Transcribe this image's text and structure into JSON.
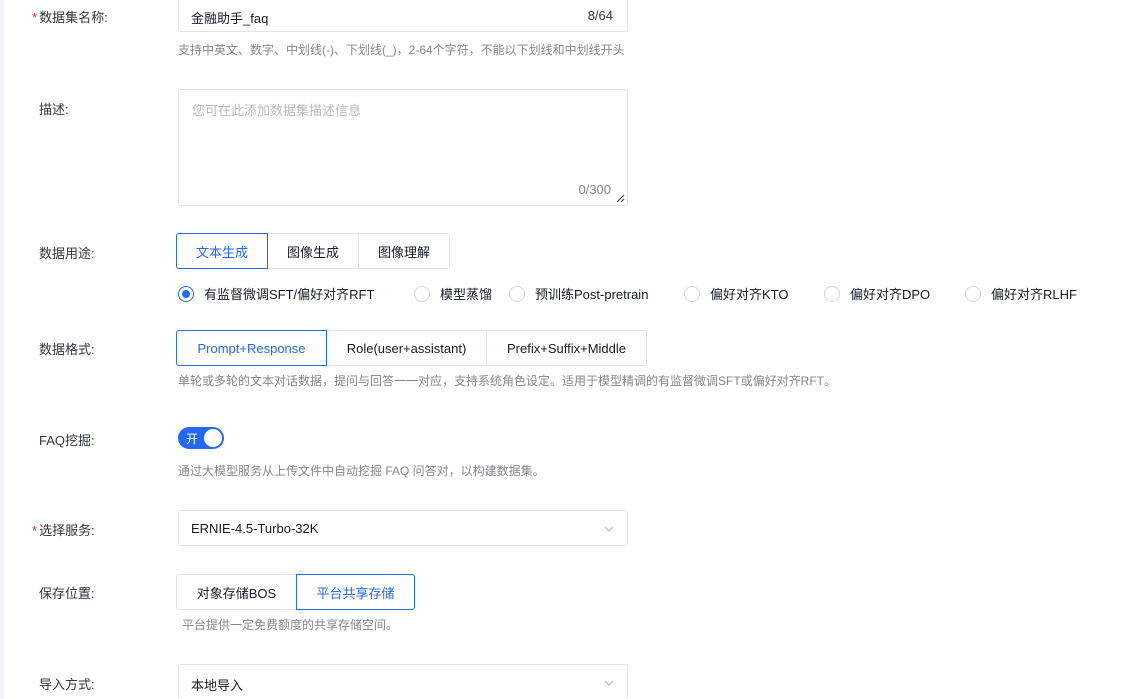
{
  "form": {
    "dataset_name": {
      "required_mark": "*",
      "label": "数据集名称:",
      "value": "金融助手_faq",
      "count": "8/64",
      "hint": "支持中英文、数字、中划线(-)、下划线(_)，2-64个字符，不能以下划线和中划线开头"
    },
    "description": {
      "label": "描述:",
      "placeholder": "您可在此添加数据集描述信息",
      "count": "0/300"
    },
    "usage": {
      "label": "数据用途:",
      "tabs": [
        "文本生成",
        "图像生成",
        "图像理解"
      ],
      "active_tab": "文本生成",
      "radios": [
        "有监督微调SFT/偏好对齐RFT",
        "模型蒸馏",
        "预训练Post-pretrain",
        "偏好对齐KTO",
        "偏好对齐DPO",
        "偏好对齐RLHF"
      ],
      "selected_radio": "有监督微调SFT/偏好对齐RFT"
    },
    "format": {
      "label": "数据格式:",
      "tabs": [
        "Prompt+Response",
        "Role(user+assistant)",
        "Prefix+Suffix+Middle"
      ],
      "active_tab": "Prompt+Response",
      "hint": "单轮或多轮的文本对话数据，提问与回答一一对应，支持系统角色设定。适用于模型精调的有监督微调SFT或偏好对齐RFT。"
    },
    "faq": {
      "label": "FAQ挖掘:",
      "switch_text": "开",
      "enabled": true,
      "hint": "通过大模型服务从上传文件中自动挖掘 FAQ 问答对，以构建数据集。"
    },
    "service": {
      "required_mark": "*",
      "label": "选择服务:",
      "value": "ERNIE-4.5-Turbo-32K"
    },
    "storage": {
      "label": "保存位置:",
      "tabs": [
        "对象存储BOS",
        "平台共享存储"
      ],
      "active_tab": "平台共享存储",
      "hint": "平台提供一定免费额度的共享存储空间。"
    },
    "import": {
      "label": "导入方式:",
      "value": "本地导入"
    }
  },
  "colors": {
    "accent": "#2468f2",
    "required": "#f5222d",
    "border": "#e3e4e8",
    "hint": "#84868c"
  }
}
